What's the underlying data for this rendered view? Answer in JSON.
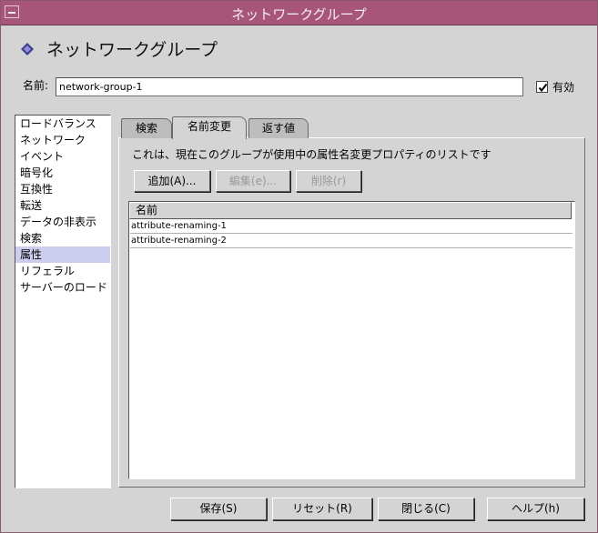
{
  "window": {
    "title": "ネットワークグループ"
  },
  "header": {
    "title": "ネットワークグループ",
    "icon": "diamond-icon"
  },
  "name_field": {
    "label": "名前:",
    "value": "network-group-1"
  },
  "enabled": {
    "label": "有効",
    "checked": true
  },
  "sidebar": {
    "items": [
      {
        "label": "ロードバランス"
      },
      {
        "label": "ネットワーク"
      },
      {
        "label": "イベント"
      },
      {
        "label": "暗号化"
      },
      {
        "label": "互換性"
      },
      {
        "label": "転送"
      },
      {
        "label": "データの非表示"
      },
      {
        "label": "検索"
      },
      {
        "label": "属性",
        "selected": true
      },
      {
        "label": "リフェラル"
      },
      {
        "label": "サーバーのロード"
      }
    ]
  },
  "tabs": [
    {
      "label": "検索"
    },
    {
      "label": "名前変更",
      "active": true
    },
    {
      "label": "返す値"
    }
  ],
  "panel": {
    "description": "これは、現在このグループが使用中の属性名変更プロパティのリストです",
    "buttons": {
      "add": "追加(A)...",
      "edit": "編集(e)...",
      "delete": "削除(r)"
    },
    "table": {
      "column": "名前",
      "rows": [
        "attribute-renaming-1",
        "attribute-renaming-2"
      ]
    }
  },
  "footer": {
    "save": "保存(S)",
    "reset": "リセット(R)",
    "close": "閉じる(C)",
    "help": "ヘルプ(h)"
  }
}
